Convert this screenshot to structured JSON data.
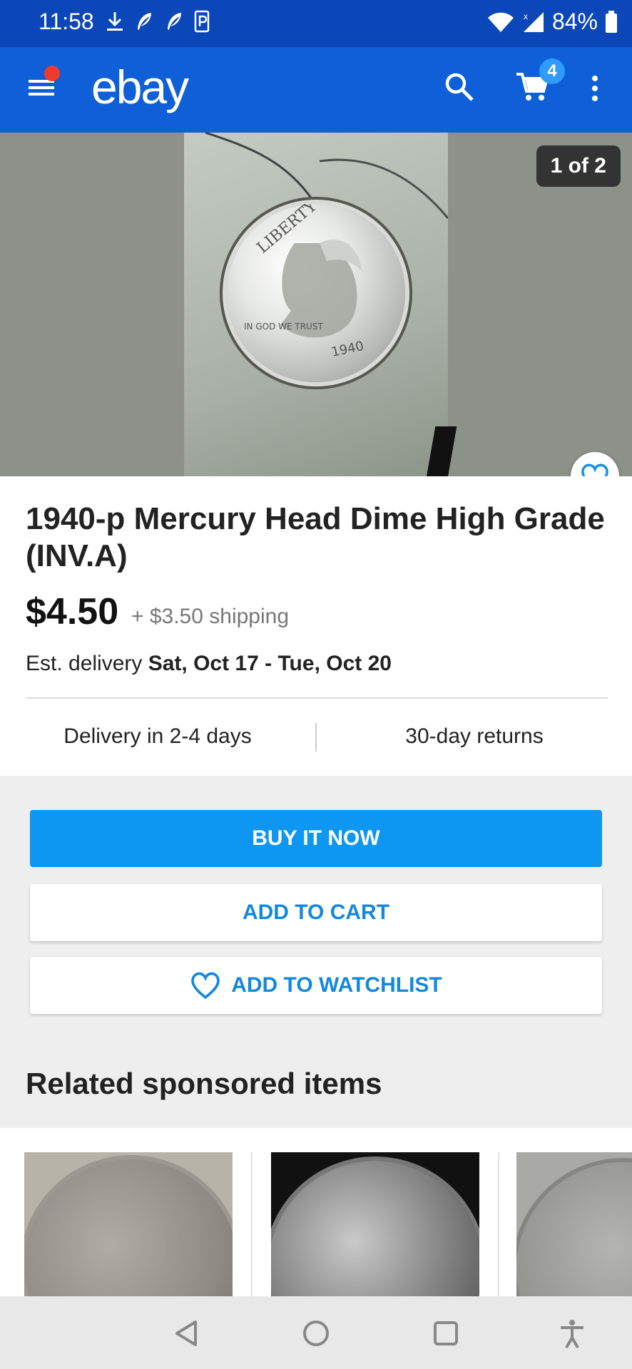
{
  "status_bar": {
    "time": "11:58",
    "battery": "84%",
    "icons_left": [
      "download-icon",
      "feather-icon",
      "feather-icon",
      "parking-icon"
    ],
    "icons_right": [
      "wifi-icon",
      "signal-icon",
      "battery-icon"
    ]
  },
  "header": {
    "logo": "ebay",
    "cart_count": "4",
    "colors": {
      "bar": "#0e5fd8",
      "status": "#0b47b8",
      "notification_dot": "#ef3b2e",
      "badge": "#2f9bff"
    }
  },
  "gallery": {
    "counter": "1 of 2",
    "coin_text": {
      "legend": "LIBERTY",
      "motto": "IN GOD WE TRUST",
      "year": "1940"
    }
  },
  "item": {
    "title": "1940-p Mercury Head Dime High Grade (INV.A)",
    "price": "$4.50",
    "shipping": "+ $3.50 shipping",
    "delivery_label": "Est. delivery",
    "delivery_dates": "Sat, Oct 17 - Tue, Oct 20",
    "feature_left": "Delivery in 2-4 days",
    "feature_right": "30-day returns"
  },
  "actions": {
    "buy_now": "BUY IT NOW",
    "add_to_cart": "ADD TO CART",
    "add_to_watchlist": "ADD TO WATCHLIST",
    "colors": {
      "primary": "#0d96f2",
      "link": "#1388dd"
    }
  },
  "related": {
    "title": "Related sponsored items"
  }
}
